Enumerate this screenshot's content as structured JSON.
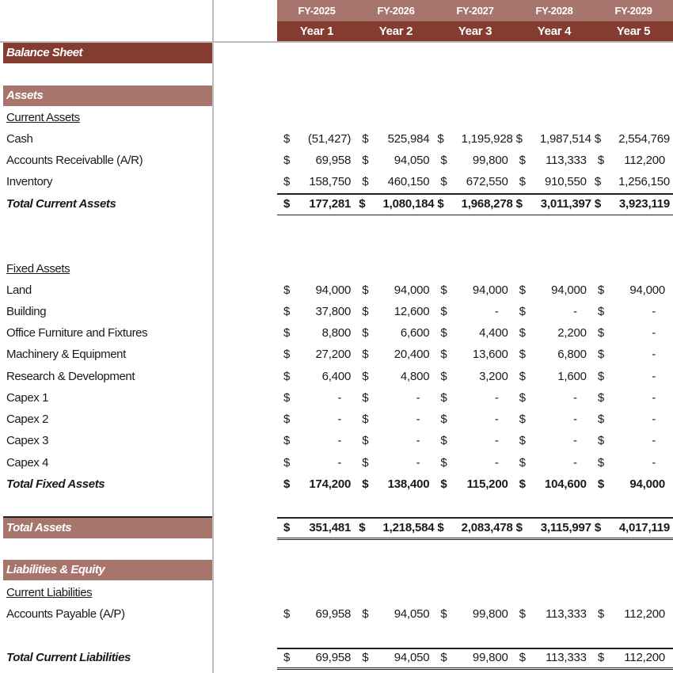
{
  "header": {
    "fiscal_years": [
      "FY-2025",
      "FY-2026",
      "FY-2027",
      "FY-2028",
      "FY-2029"
    ],
    "years": [
      "Year 1",
      "Year 2",
      "Year 3",
      "Year 4",
      "Year 5"
    ]
  },
  "sheet": {
    "title": "Balance Sheet",
    "assets_band": "Assets",
    "current_assets_heading": "Current Assets",
    "current_assets": [
      {
        "label": "Cash",
        "values": [
          "(51,427)",
          "525,984",
          "1,195,928",
          "1,987,514",
          "2,554,769"
        ]
      },
      {
        "label": "Accounts Receivablle (A/R)",
        "values": [
          "69,958",
          "94,050",
          "99,800",
          "113,333",
          "112,200"
        ]
      },
      {
        "label": "Inventory",
        "values": [
          "158,750",
          "460,150",
          "672,550",
          "910,550",
          "1,256,150"
        ]
      }
    ],
    "total_current_assets": {
      "label": "Total Current Assets",
      "values": [
        "177,281",
        "1,080,184",
        "1,968,278",
        "3,011,397",
        "3,923,119"
      ]
    },
    "fixed_assets_heading": "Fixed Assets",
    "fixed_assets": [
      {
        "label": "Land",
        "values": [
          "94,000",
          "94,000",
          "94,000",
          "94,000",
          "94,000"
        ]
      },
      {
        "label": "Building",
        "values": [
          "37,800",
          "12,600",
          "-",
          "-",
          "-"
        ]
      },
      {
        "label": "Office Furniture and Fixtures",
        "values": [
          "8,800",
          "6,600",
          "4,400",
          "2,200",
          "-"
        ]
      },
      {
        "label": "Machinery & Equipment",
        "values": [
          "27,200",
          "20,400",
          "13,600",
          "6,800",
          "-"
        ]
      },
      {
        "label": "Research & Development",
        "values": [
          "6,400",
          "4,800",
          "3,200",
          "1,600",
          "-"
        ]
      },
      {
        "label": "Capex 1",
        "values": [
          "-",
          "-",
          "-",
          "-",
          "-"
        ]
      },
      {
        "label": "Capex 2",
        "values": [
          "-",
          "-",
          "-",
          "-",
          "-"
        ]
      },
      {
        "label": "Capex 3",
        "values": [
          "-",
          "-",
          "-",
          "-",
          "-"
        ]
      },
      {
        "label": "Capex 4",
        "values": [
          "-",
          "-",
          "-",
          "-",
          "-"
        ]
      }
    ],
    "total_fixed_assets": {
      "label": "Total Fixed Assets",
      "values": [
        "174,200",
        "138,400",
        "115,200",
        "104,600",
        "94,000"
      ]
    },
    "total_assets": {
      "label": "Total Assets",
      "values": [
        "351,481",
        "1,218,584",
        "2,083,478",
        "3,115,997",
        "4,017,119"
      ]
    },
    "liabilities_band": "Liabilities & Equity",
    "current_liabilities_heading": "Current Liabilities",
    "current_liabilities": [
      {
        "label": "Accounts Payable (A/P)",
        "values": [
          "69,958",
          "94,050",
          "99,800",
          "113,333",
          "112,200"
        ]
      }
    ],
    "total_current_liabilities": {
      "label": "Total Current Liabilities",
      "values": [
        "69,958",
        "94,050",
        "99,800",
        "113,333",
        "112,200"
      ]
    },
    "currency_symbol": "$"
  },
  "colors": {
    "header_light": "#a8756d",
    "header_dark": "#843b30"
  }
}
